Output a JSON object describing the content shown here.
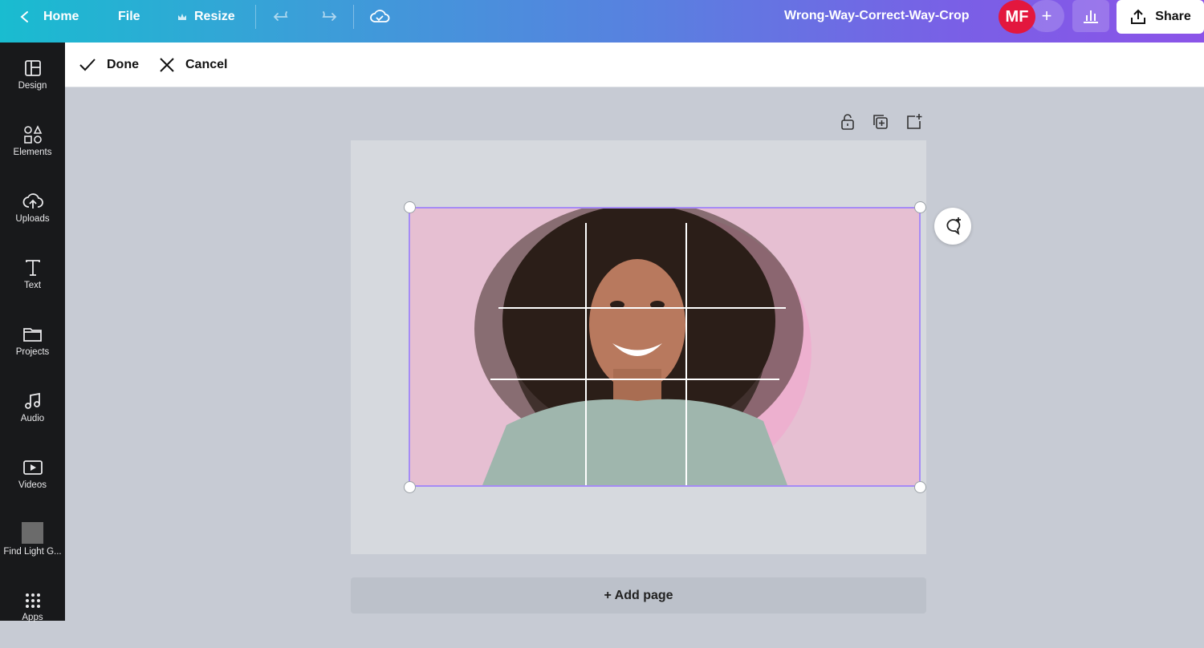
{
  "topbar": {
    "home_label": "Home",
    "file_label": "File",
    "resize_label": "Resize",
    "document_title": "Wrong-Way-Correct-Way-Crop",
    "avatar_initials": "MF",
    "share_label": "Share",
    "avatar_color": "#e3173e"
  },
  "sidebar": {
    "items": [
      {
        "label": "Design",
        "icon": "layout-icon"
      },
      {
        "label": "Elements",
        "icon": "shapes-icon"
      },
      {
        "label": "Uploads",
        "icon": "cloud-upload-icon"
      },
      {
        "label": "Text",
        "icon": "text-icon"
      },
      {
        "label": "Projects",
        "icon": "folder-icon"
      },
      {
        "label": "Audio",
        "icon": "music-note-icon"
      },
      {
        "label": "Videos",
        "icon": "video-icon"
      },
      {
        "label": "Find Light G...",
        "icon": "thumbnail"
      },
      {
        "label": "Apps",
        "icon": "grid-icon"
      }
    ]
  },
  "crop_toolbar": {
    "done_label": "Done",
    "cancel_label": "Cancel"
  },
  "canvas": {
    "add_page_label": "+ Add page",
    "selection_color": "#a68bf5",
    "image_background": "#e6bfd2"
  }
}
